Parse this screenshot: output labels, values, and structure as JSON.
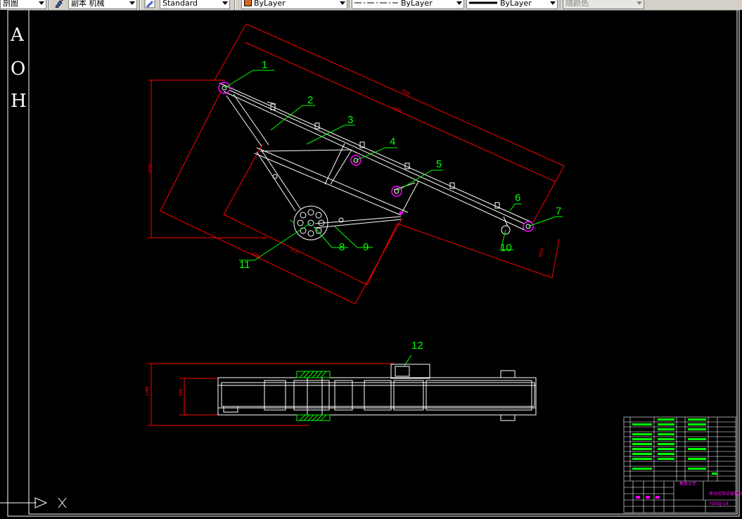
{
  "toolbar": {
    "view_label": "剖图",
    "layer_label": "副本 机械",
    "text_style": "Standard",
    "color": "ByLayer",
    "color_swatch": "#d2691e",
    "linetype": "ByLayer",
    "lineweight": "ByLayer",
    "plot_style": "随颜色"
  },
  "ucs": {
    "axis_labels": [
      "A",
      "O",
      "H"
    ]
  },
  "drawing": {
    "callouts": [
      "1",
      "2",
      "3",
      "4",
      "5",
      "6",
      "7",
      "8",
      "9",
      "10",
      "11",
      "12"
    ],
    "dims": {
      "overall_length": "7538",
      "belt_length": "6988",
      "height": "3818",
      "base_length": "4488",
      "base_span": "3222",
      "end_offset": "9593",
      "plan_width_outer": "1088",
      "plan_width_inner": "688"
    }
  },
  "title_block": {
    "company": "集美大学",
    "drawing_name": "移动式带式输送机",
    "drawing_no": "YDSSJ-18"
  },
  "colors": {
    "background": "#000000",
    "outline": "#ffffff",
    "dimension": "#ff0000",
    "leader": "#00ff00",
    "accent": "#ff00ff"
  }
}
